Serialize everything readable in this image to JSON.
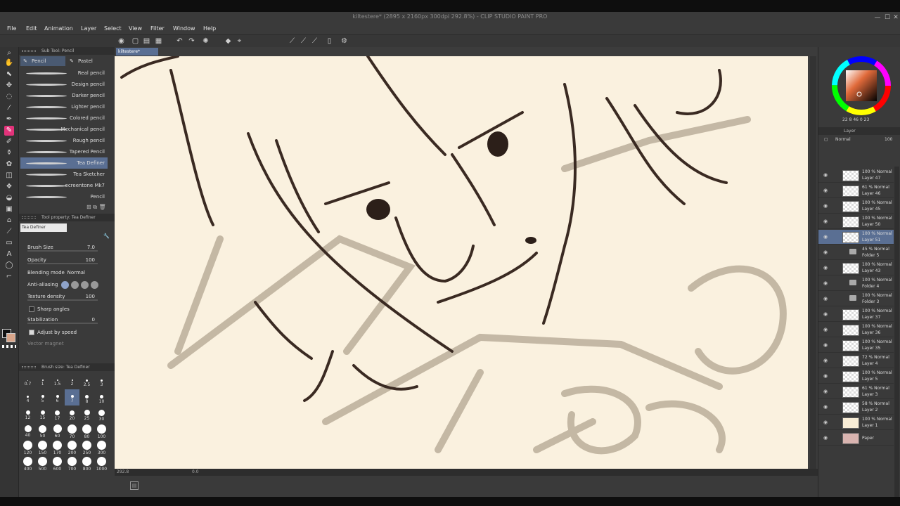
{
  "window": {
    "title": "kiltestere* (2895 x 2160px 300dpi 292.8%)  - CLIP STUDIO PAINT PRO",
    "controls": [
      "minimize-icon",
      "maximize-icon",
      "close-icon"
    ]
  },
  "menu": [
    "File",
    "Edit",
    "Animation",
    "Layer",
    "Select",
    "View",
    "Filter",
    "Window",
    "Help"
  ],
  "sub_tool": {
    "header": "Sub Tool: Pencil",
    "tabs": [
      "Pencil",
      "Pastel"
    ],
    "brushes": [
      "Real pencil",
      "Design pencil",
      "Darker pencil",
      "Lighter pencil",
      "Colored pencil",
      "Mechanical pencil",
      "Rough pencil",
      "Tapered Pencil",
      "Tea Definer",
      "Tea Sketcher",
      "ecreentone Mk7",
      "Pencil"
    ],
    "selected_brush": "Tea Definer"
  },
  "tool_property": {
    "header": "Tool property: Tea Definer",
    "preset_name": "Tea Definer",
    "brush_size_label": "Brush Size",
    "brush_size_value": "7.0",
    "opacity_label": "Opacity",
    "opacity_value": "100",
    "blending_label": "Blending mode",
    "blending_value": "Normal",
    "antialias_label": "Anti-aliasing",
    "texture_label": "Texture density",
    "texture_value": "100",
    "sharp_label": "Sharp angles",
    "stabilization_label": "Stabilization",
    "stabilization_value": "0",
    "adjust_label": "Adjust by speed",
    "vector_label": "Vector magnet"
  },
  "brush_size_palette": {
    "header": "Brush size: Tea Definer",
    "sizes": [
      "0.7",
      "1",
      "1.5",
      "2",
      "2.5",
      "3",
      "4",
      "5",
      "6",
      "7",
      "8",
      "10",
      "12",
      "15",
      "17",
      "20",
      "25",
      "30",
      "40",
      "50",
      "60",
      "70",
      "80",
      "100",
      "120",
      "150",
      "170",
      "200",
      "250",
      "300",
      "400",
      "500",
      "600",
      "700",
      "800",
      "1000"
    ],
    "selected": "7"
  },
  "canvas": {
    "tab_label": "kiltestere*",
    "zoom": "292.8",
    "rotation": "0.0"
  },
  "color_wheel": {
    "values": [
      "22",
      "8",
      "46",
      "0",
      "23"
    ]
  },
  "layer_panel": {
    "header": "Layer",
    "blend_mode": "Normal",
    "opacity": "100",
    "layers": [
      {
        "line1": "100 % Normal",
        "line2": "Layer 47",
        "kind": "layer"
      },
      {
        "line1": "61 % Normal",
        "line2": "Layer 46",
        "kind": "layer"
      },
      {
        "line1": "100 % Normal",
        "line2": "Layer 45",
        "kind": "layer"
      },
      {
        "line1": "100 % Normal",
        "line2": "Layer 50",
        "kind": "layer"
      },
      {
        "line1": "100 % Normal",
        "line2": "Layer 51",
        "kind": "layer",
        "selected": true
      },
      {
        "line1": "45 % Normal",
        "line2": "Folder 5",
        "kind": "folder"
      },
      {
        "line1": "100 % Normal",
        "line2": "Layer 43",
        "kind": "layer"
      },
      {
        "line1": "100 % Normal",
        "line2": "Folder 4",
        "kind": "folder"
      },
      {
        "line1": "100 % Normal",
        "line2": "Folder 3",
        "kind": "folder"
      },
      {
        "line1": "100 % Normal",
        "line2": "Layer 37",
        "kind": "layer"
      },
      {
        "line1": "100 % Normal",
        "line2": "Layer 36",
        "kind": "layer"
      },
      {
        "line1": "100 % Normal",
        "line2": "Layer 35",
        "kind": "layer"
      },
      {
        "line1": "72 % Normal",
        "line2": "Layer 4",
        "kind": "layer"
      },
      {
        "line1": "100 % Normal",
        "line2": "Layer 5",
        "kind": "layer"
      },
      {
        "line1": "61 % Normal",
        "line2": "Layer 3",
        "kind": "layer"
      },
      {
        "line1": "58 % Normal",
        "line2": "Layer 2",
        "kind": "layer"
      },
      {
        "line1": "100 % Normal",
        "line2": "Layer 1",
        "kind": "cream"
      },
      {
        "line1": "",
        "line2": "Paper",
        "kind": "paper"
      }
    ]
  },
  "colors": {
    "accent_tool": "#e2337a",
    "selection": "#5a6f93",
    "canvas_bg": "#faf1df",
    "main_color": "#d9a58a",
    "sub_color": "#000000"
  }
}
